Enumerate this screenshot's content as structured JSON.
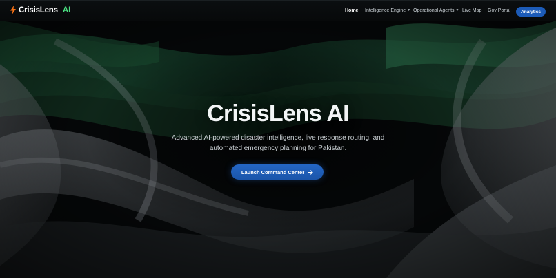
{
  "brand": {
    "name": "CrisisLens",
    "suffix": "AI",
    "icon": "bolt-icon",
    "icon_color": "#f97316",
    "suffix_color": "#4ade80"
  },
  "nav": {
    "items": [
      {
        "label": "Home",
        "active": true
      },
      {
        "label": "Intelligence Engine",
        "dropdown": true
      },
      {
        "label": "Operational Agents",
        "dropdown": true
      },
      {
        "label": "Live Map"
      },
      {
        "label": "Gov Portal"
      }
    ],
    "cta_label": "Analytics",
    "cta_color": "#1c5bb8"
  },
  "hero": {
    "title": "CrisisLens AI",
    "subtitle_line1": "Advanced AI-powered disaster intelligence, live response routing, and",
    "subtitle_line2": "automated emergency planning for Pakistan.",
    "cta_label": "Launch Command Center",
    "cta_icon": "arrow-right-icon",
    "cta_color": "#2466c4"
  },
  "colors": {
    "background": "#050708",
    "wave_green": "#1f5a3c",
    "wave_gray": "#6b7075"
  }
}
